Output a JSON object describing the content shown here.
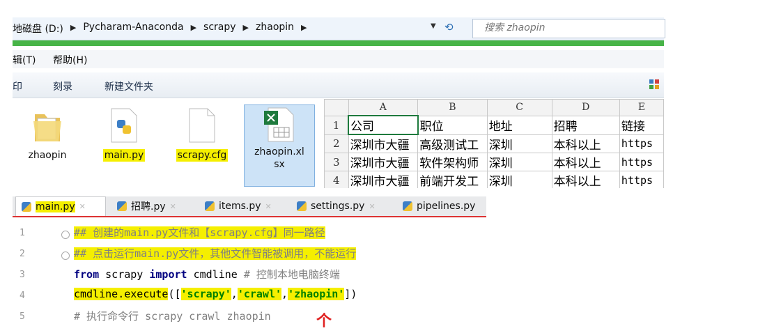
{
  "address_bar": {
    "crumbs": [
      "地磁盘 (D:)",
      "Pycharam-Anaconda",
      "scrapy",
      "zhaopin"
    ],
    "search_placeholder": "搜索 zhaopin"
  },
  "menu": [
    "辑(T)",
    "帮助(H)"
  ],
  "toolbar": [
    "印",
    "刻录",
    "新建文件夹"
  ],
  "files": [
    {
      "name": "zhaopin",
      "icon": "folder-icon",
      "highlighted": false
    },
    {
      "name": "main.py",
      "icon": "python-file-icon",
      "highlighted": true
    },
    {
      "name": "scrapy.cfg",
      "icon": "blank-file-icon",
      "highlighted": true
    },
    {
      "name_line1": "zhaopin.xl",
      "name_line2": "sx",
      "icon": "excel-file-icon",
      "selected": true
    }
  ],
  "sheet": {
    "columns": [
      "A",
      "B",
      "C",
      "D",
      "E"
    ],
    "rows": [
      {
        "n": "1",
        "cells": [
          "公司",
          "职位",
          "地址",
          "招聘",
          "链接"
        ]
      },
      {
        "n": "2",
        "cells": [
          "深圳市大疆",
          "高级测试工",
          "深圳",
          "本科以上",
          "https"
        ]
      },
      {
        "n": "3",
        "cells": [
          "深圳市大疆",
          "软件架构师",
          "深圳",
          "本科以上",
          "https"
        ]
      },
      {
        "n": "4",
        "cells": [
          "深圳市大疆",
          "前端开发工",
          "深圳",
          "本科以上",
          "https"
        ]
      }
    ]
  },
  "tabs": [
    "main.py",
    "招聘.py",
    "items.py",
    "settings.py",
    "pipelines.py"
  ],
  "code": {
    "line_numbers": [
      "1",
      "2",
      "3",
      "4",
      "5"
    ],
    "l1": "## 创建的main.py文件和【scrapy.cfg】同一路径",
    "l2": "## 点击运行main.py文件，其他文件智能被调用，不能运行",
    "l3_kw1": "from",
    "l3_mid": " scrapy ",
    "l3_kw2": "import",
    "l3_end": " cmdline",
    "l3_cmt": "  # 控制本地电脑终端",
    "l4_call": "cmdline.execute",
    "l4_open": "([",
    "l4_s1": "'scrapy'",
    "l4_c1": ",",
    "l4_s2": "'crawl'",
    "l4_c2": ",",
    "l4_s3": "'zhaopin'",
    "l4_close": "])",
    "l5_cmt": "# 执行命令行 scrapy crawl zhaopin",
    "arrow": "个"
  },
  "colors": {
    "highlight": "#f5ef00",
    "stripe": "#47b447",
    "tab_underline": "#dd3333"
  }
}
